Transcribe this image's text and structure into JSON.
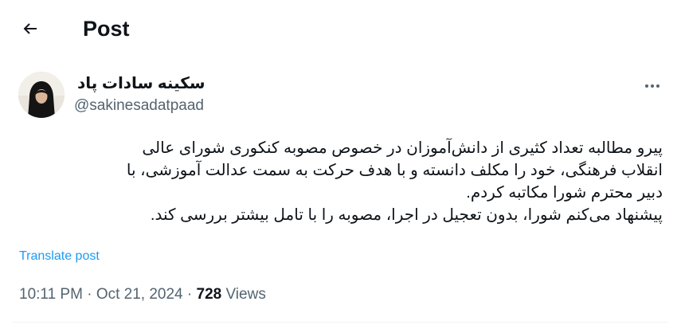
{
  "header": {
    "title": "Post"
  },
  "icons": {
    "back": "arrow-left-icon",
    "more": "more-horizontal-icon"
  },
  "author": {
    "name": "سکینه سادات پاد",
    "handle": "@sakinesadatpaad"
  },
  "tweet": {
    "lines": [
      "پیرو مطالبه تعداد کثیری از دانش‌آموزان در خصوص مصوبه کنکوری شورای عالی",
      "انقلاب فرهنگی، خود را مکلف دانسته و با هدف حرکت به سمت عدالت آموزشی، با",
      "دبیر محترم شورا مکاتبه کردم.",
      "پیشنهاد می‌کنم شورا، بدون تعجیل در اجرا، مصوبه را با تامل بیشتر بررسی کند."
    ],
    "translate_label": "Translate post"
  },
  "meta": {
    "time": "10:11 PM",
    "separator": " · ",
    "date": "Oct 21, 2024",
    "views_count": "728",
    "views_label": " Views"
  },
  "colors": {
    "text": "#0f1419",
    "secondary": "#536471",
    "link": "#1d9bf0",
    "divider": "#eff3f4"
  }
}
